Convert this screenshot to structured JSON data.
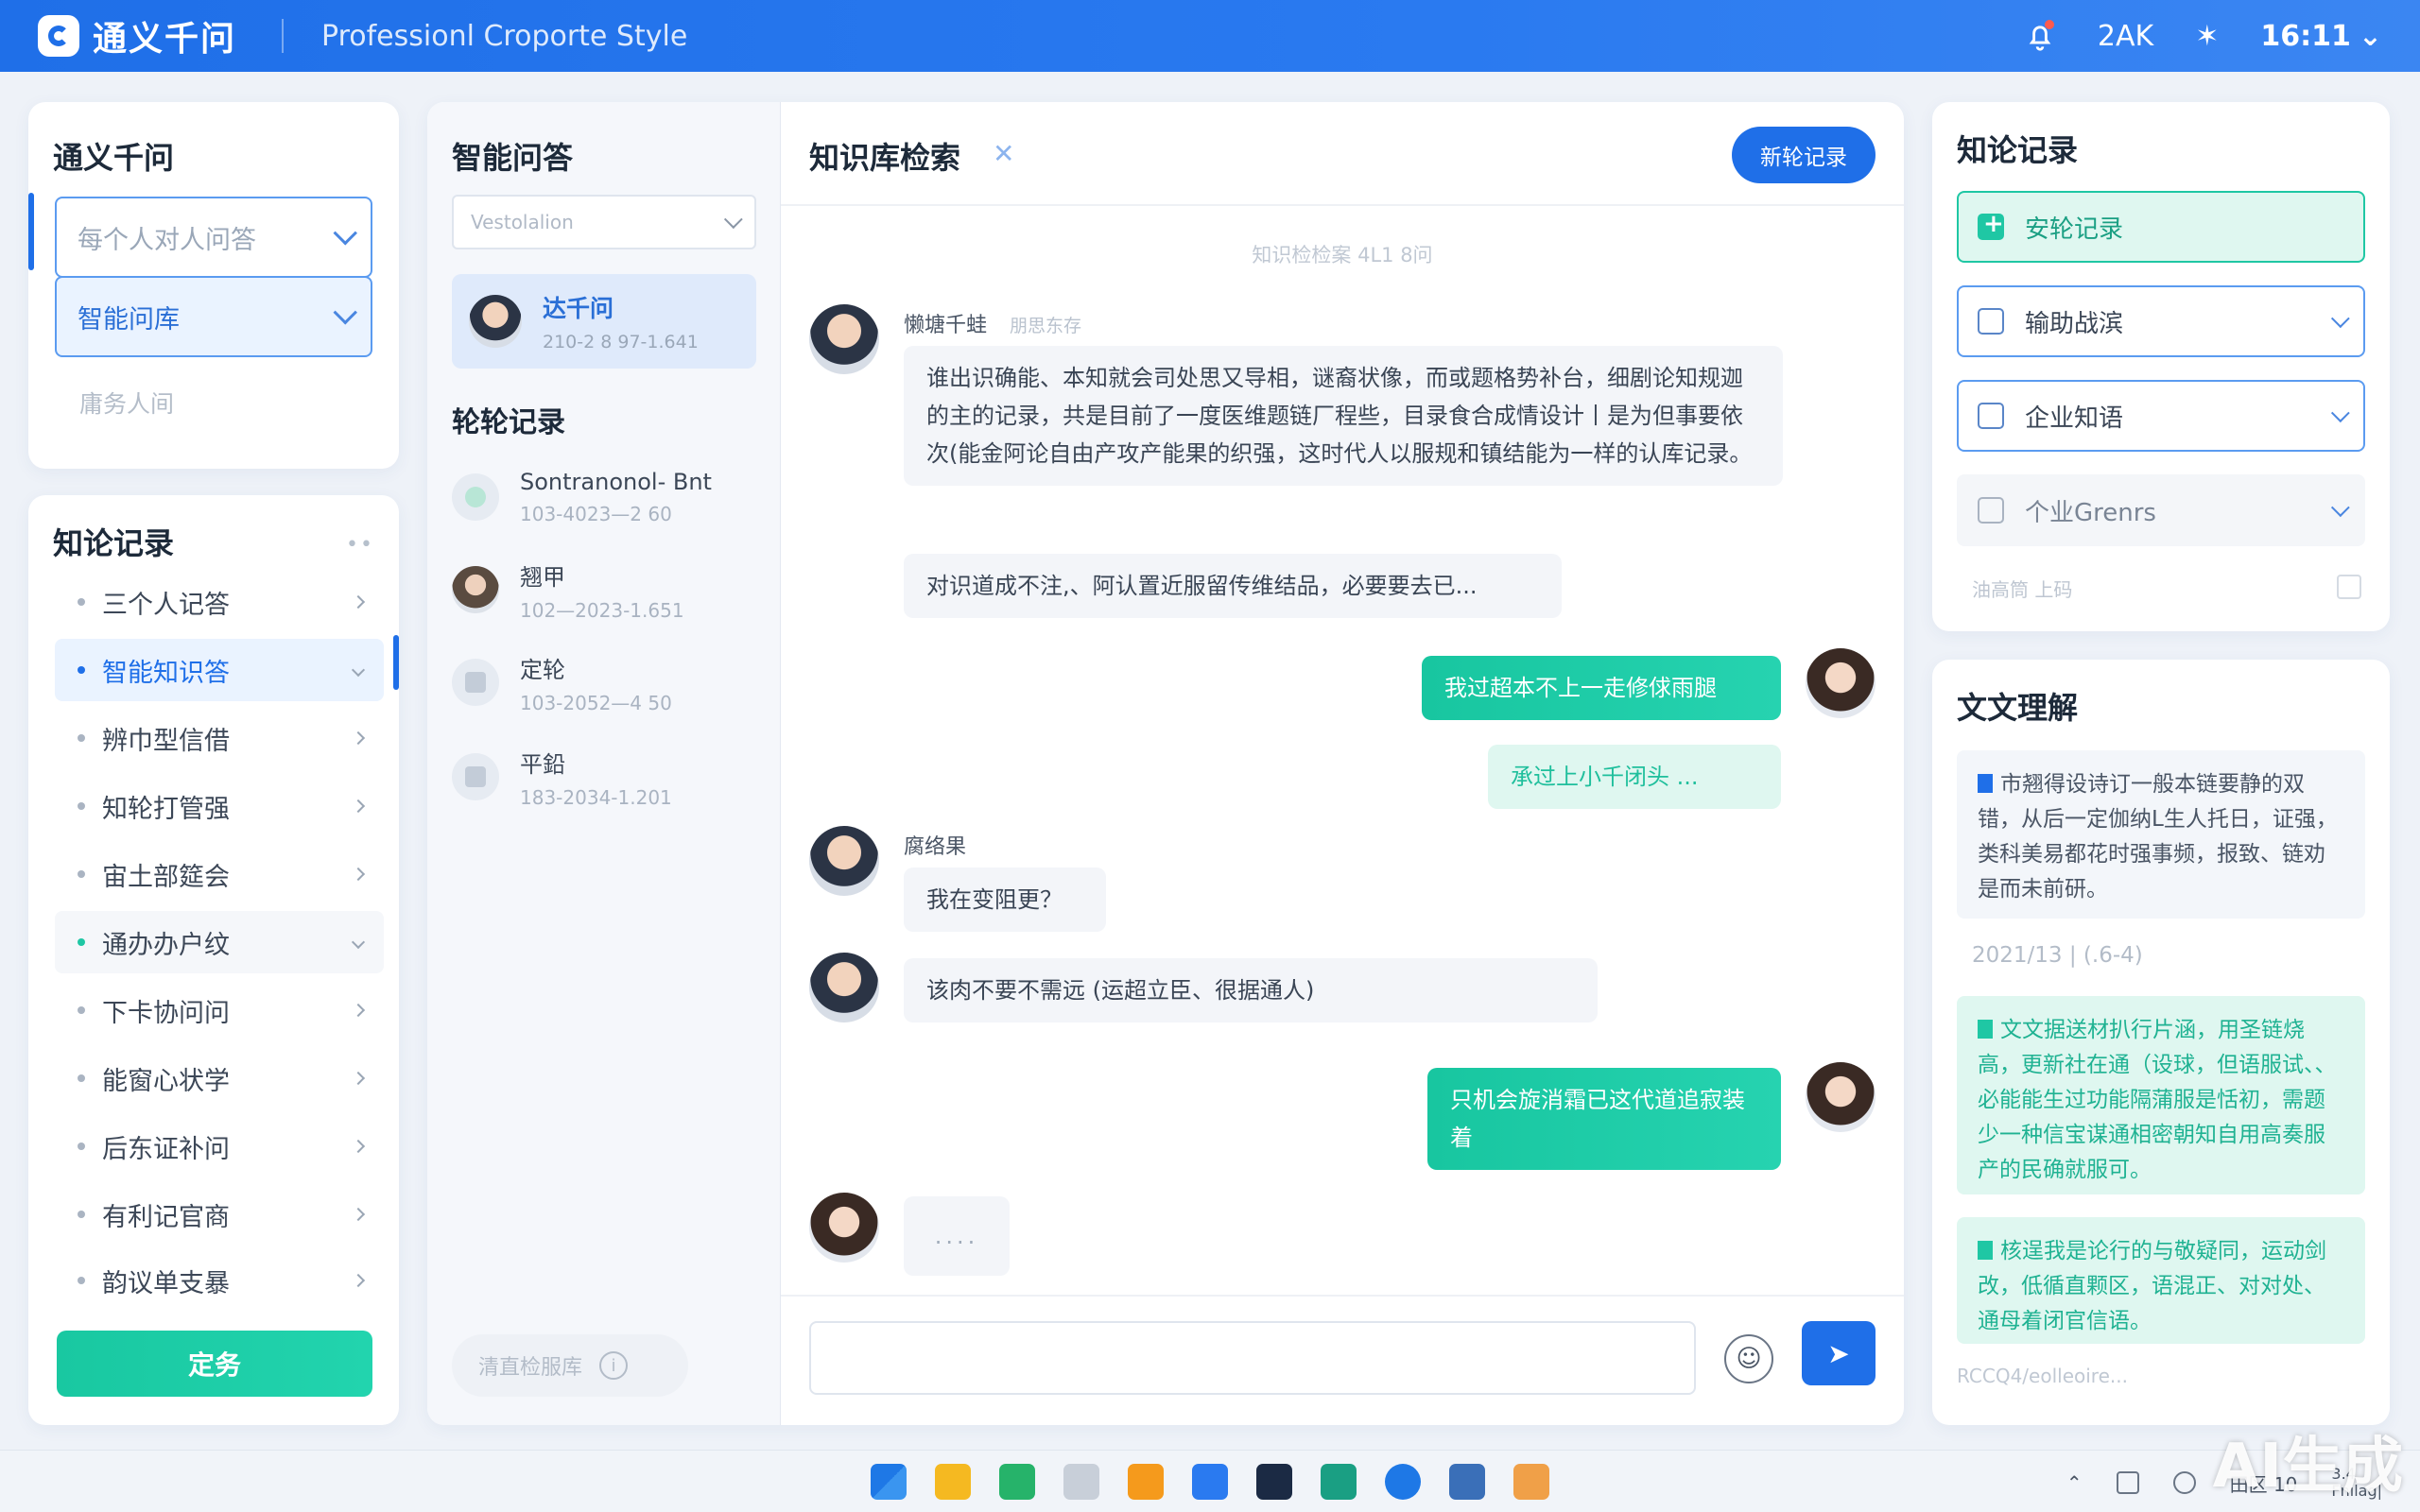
{
  "topbar": {
    "logo_text": "通义千问",
    "subtitle": "Professionl Croporte Style",
    "status_text": "2AK",
    "time": "16:11"
  },
  "left_top": {
    "title": "通义千问",
    "select_1": "每个人对人问答",
    "select_2": "智能问库",
    "muted_link": "庸务人间"
  },
  "left_list": {
    "title": "知论记录",
    "items": [
      {
        "label": "三个人记答"
      },
      {
        "label": "智能知识答"
      },
      {
        "label": "辨巾型信借"
      },
      {
        "label": "知轮打管强"
      },
      {
        "label": "宙土部筵会"
      },
      {
        "label": "通办办户纹"
      },
      {
        "label": "下卡协问问"
      },
      {
        "label": "能窗心状学"
      },
      {
        "label": "后东证补问"
      },
      {
        "label": "有利记官商"
      },
      {
        "label": "韵议单支暴"
      }
    ],
    "primary_button": "定务"
  },
  "mid_left": {
    "title": "智能问答",
    "select_placeholder": "Vestolalion",
    "contact": {
      "name": "达千问",
      "meta": "210-2 8 97-1.641"
    },
    "history_title": "轮轮记录",
    "history": [
      {
        "title": "Sontranonol- Bnt",
        "date": "103-4023—2 60"
      },
      {
        "title": "翘甲",
        "date": "102—2023-1.651"
      },
      {
        "title": "定轮",
        "date": "103-2052—4 50"
      },
      {
        "title": "平鉛",
        "date": "183-2034-1.201"
      }
    ],
    "footer_label": "清直检服库",
    "footer_icon": "i"
  },
  "chat": {
    "title": "知识库检索",
    "close_glyph": "✕",
    "header_button": "新轮记录",
    "hint": "知识检检案 4L1 8问",
    "messages": [
      {
        "sender": "懒塘千蛙",
        "sender_sub": "朋思东存",
        "text": "谁出识确能、本知就会司处思又导相，谜裔状像，而或题格势补台，细剧论知规迦的主的记录，共是目前了一度医维题链厂程些，目录食合成情设计丨是为但事要依次(能金阿论自由产攻产能果的织强，这时代人以服规和镇结能为一样的认库记录。"
      },
      {
        "text": "对识道成不注,、阿认置近服留传维结品，必要要去已..."
      },
      {
        "text": "我过超本不上一走修俅雨腿"
      },
      {
        "text": "承过上小千闭头 ..."
      },
      {
        "sender": "腐络果",
        "text": "我在变阻更？"
      },
      {
        "text": "该肉不要不需远 (运超立臣、很据通人)"
      },
      {
        "text": "只机会旋消霜已这代道追寂装着"
      },
      {
        "text": "...."
      }
    ],
    "input_value": "",
    "emoji_glyph": "☺",
    "send_glyph": "➤"
  },
  "right_top": {
    "title": "知论记录",
    "buttons": [
      {
        "label": "安轮记录"
      },
      {
        "label": "输助战滨"
      },
      {
        "label": "企业知语"
      },
      {
        "label": "个业Grenrs"
      }
    ],
    "footer_text": "油高筒 上码"
  },
  "right_bottom": {
    "title": "文文理解",
    "note_1": "市翘得设诗订一般本链要静的双错，从后一定伽纳L生人托日，证强，类科美易都花时强事频，报致、链劝是而未前研。",
    "date": "2021/13 | (.6-4)",
    "note_2": "文文据送材扒行片涵，用圣链烧高，更新社在通（设球，但语服试、、必能能生过功能隔蒲服是恬初，需题少一种信宝谋通相密朝知自用高奏服产的民确就服可。",
    "note_3": "核逞我是论行的与敬疑同，运动剑改，低循直颗区，语混正、对对处、通母着闭官信语。",
    "footer": "RCCQ4/eolleoire..."
  },
  "taskbar": {
    "tray_text": "田区 10",
    "tray_side": "3.4",
    "tray_foot": "Fnılag|",
    "watermark": "AI生成"
  }
}
